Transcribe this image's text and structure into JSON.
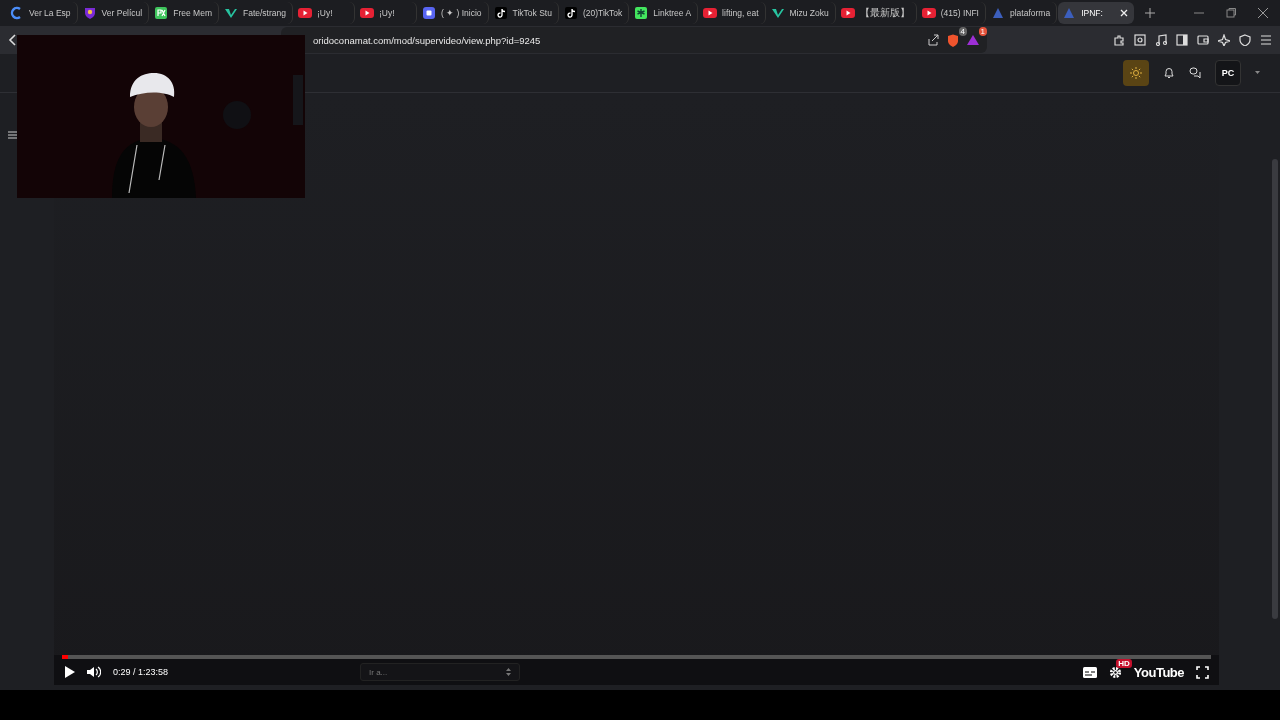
{
  "tabs": [
    {
      "kind": "c-logo",
      "label": "Ver La Esp",
      "selected": false
    },
    {
      "kind": "shield",
      "label": "Ver Películ",
      "selected": false
    },
    {
      "kind": "px",
      "label": "Free Mem",
      "selected": false
    },
    {
      "kind": "v-logo",
      "label": "Fate/strang",
      "selected": false
    },
    {
      "kind": "play",
      "label": "¡Uy!",
      "selected": false
    },
    {
      "kind": "play",
      "label": "¡Uy!",
      "selected": false
    },
    {
      "kind": "square",
      "label": "( ✦ ) Inicio",
      "selected": false
    },
    {
      "kind": "note",
      "label": "TikTok Stu",
      "selected": false
    },
    {
      "kind": "note",
      "label": "(20)TikTok",
      "selected": false
    },
    {
      "kind": "tree",
      "label": "Linktree A",
      "selected": false
    },
    {
      "kind": "play",
      "label": "lifting, eat",
      "selected": false
    },
    {
      "kind": "v-logo",
      "label": "Mizu Zoku",
      "selected": false
    },
    {
      "kind": "play",
      "label": "【最新版】",
      "selected": false
    },
    {
      "kind": "play",
      "label": "(415) INFI",
      "selected": false
    },
    {
      "kind": "triangle",
      "label": "plataforma",
      "selected": false
    },
    {
      "kind": "triangle",
      "label": "IPNF:",
      "selected": true
    }
  ],
  "address_bar": {
    "url": "oridoconamat.com/mod/supervideo/view.php?id=9245",
    "shield_badge": "4",
    "rewards_badge": "1"
  },
  "header": {
    "avatar": "PC"
  },
  "player": {
    "progress": {
      "level": 0.005
    },
    "time": "0:29 / 1:23:58",
    "chapter_select": {
      "placeholder": "Ir a..."
    },
    "hd_badge": "HD",
    "logo": "YouTube"
  }
}
